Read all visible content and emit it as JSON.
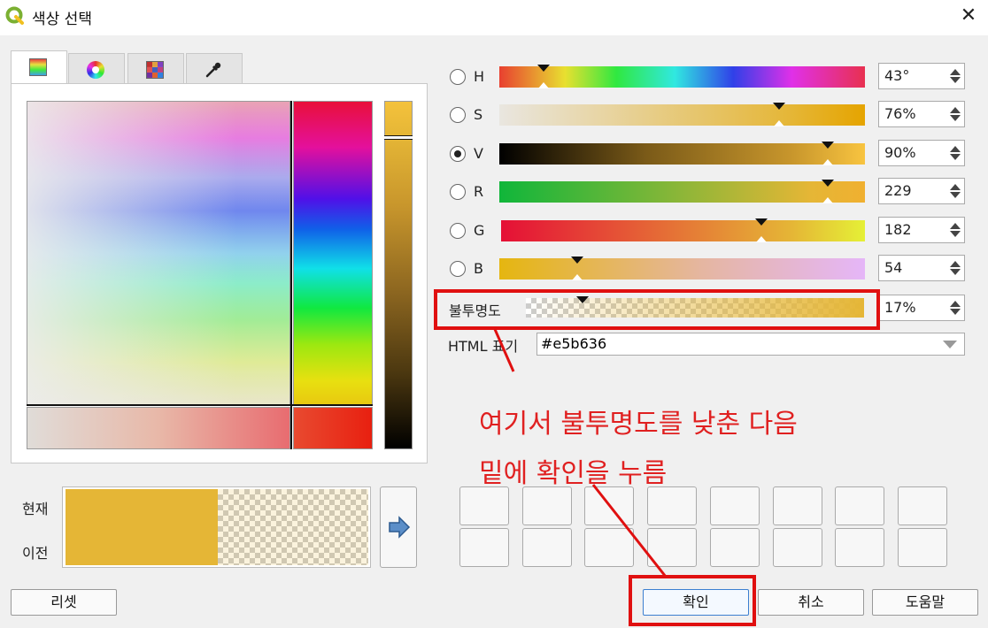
{
  "window": {
    "title": "색상 선택",
    "close_symbol": "✕"
  },
  "tabs": [
    {
      "name": "color-ramp",
      "active": true
    },
    {
      "name": "color-wheel",
      "active": false
    },
    {
      "name": "color-swatches",
      "active": false
    },
    {
      "name": "color-picker",
      "active": false
    }
  ],
  "channels": [
    {
      "label": "H",
      "value": "43°",
      "checked": false
    },
    {
      "label": "S",
      "value": "76%",
      "checked": false
    },
    {
      "label": "V",
      "value": "90%",
      "checked": true
    },
    {
      "label": "R",
      "value": "229",
      "checked": false
    },
    {
      "label": "G",
      "value": "182",
      "checked": false
    },
    {
      "label": "B",
      "value": "54",
      "checked": false
    }
  ],
  "opacity": {
    "label": "불투명도",
    "value": "17%"
  },
  "html_notation": {
    "label": "HTML 표기",
    "value": "#e5b636"
  },
  "preview": {
    "current_label": "현재",
    "previous_label": "이전",
    "current_color": "#e5b636"
  },
  "buttons": {
    "reset": "리셋",
    "ok": "확인",
    "cancel": "취소",
    "help": "도움말"
  },
  "annotation": {
    "line1": "여기서 불투명도를 낮춘 다음",
    "line2": "밑에 확인을 누름",
    "color": "#e02020"
  }
}
